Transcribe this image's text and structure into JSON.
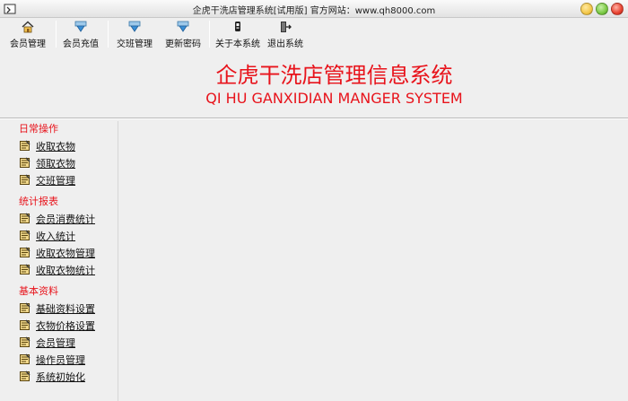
{
  "window": {
    "title": "企虎干洗店管理系统[试用版] 官方网站：www.qh8000.com",
    "controls": [
      {
        "name": "minimize-button",
        "color": "#f3c74a"
      },
      {
        "name": "maximize-button",
        "color": "#7ac943"
      },
      {
        "name": "close-button",
        "color": "#e8412f"
      }
    ]
  },
  "toolbar": {
    "items": [
      {
        "label": "会员管理",
        "icon": "home-icon"
      },
      {
        "label": "会员充值",
        "icon": "download-arrow-icon"
      },
      {
        "label": "交班管理",
        "icon": "download-arrow-icon"
      },
      {
        "label": "更新密码",
        "icon": "download-arrow-icon"
      },
      {
        "label": "关于本系统",
        "icon": "about-icon"
      },
      {
        "label": "退出系统",
        "icon": "exit-door-icon"
      }
    ]
  },
  "banner": {
    "title_cn": "企虎干洗店管理信息系统",
    "title_en": "QI HU GANXIDIAN MANGER SYSTEM",
    "color": "#e8131b"
  },
  "sidebar": {
    "sections": [
      {
        "title": "日常操作",
        "items": [
          "收取衣物",
          "领取衣物",
          "交班管理"
        ]
      },
      {
        "title": "统计报表",
        "items": [
          "会员消费统计",
          "收入统计",
          "收取衣物管理",
          "收取衣物统计"
        ]
      },
      {
        "title": "基本资料",
        "items": [
          "基础资料设置",
          "衣物价格设置",
          "会员管理",
          "操作员管理",
          "系统初始化"
        ]
      }
    ]
  }
}
